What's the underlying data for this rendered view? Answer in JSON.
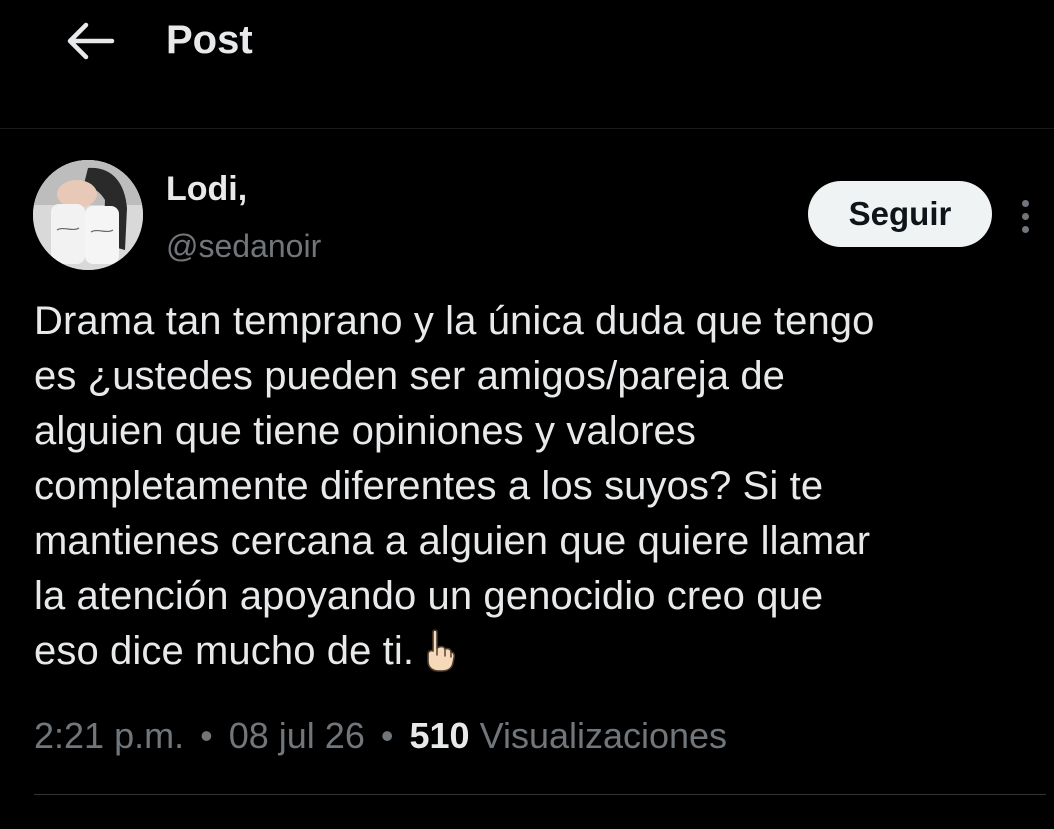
{
  "header": {
    "title": "Post"
  },
  "author": {
    "display_name": "Lodi,",
    "handle": "@sedanoir"
  },
  "follow_label": "Seguir",
  "post": {
    "lines": [
      "Drama tan temprano y la única duda que tengo",
      "es ¿ustedes pueden ser amigos/pareja de",
      "alguien que tiene opiniones y valores",
      "completamente diferentes a los suyos? Si te",
      "mantienes cercana a alguien que quiere llamar",
      "la atención apoyando un genocidio creo que",
      "eso dice mucho de ti."
    ],
    "emoji": "pointing-up-hand-icon"
  },
  "meta": {
    "time": "2:21 p.m.",
    "separator": "•",
    "date": "08 jul 26",
    "views_count": "510",
    "views_label": "Visualizaciones"
  }
}
